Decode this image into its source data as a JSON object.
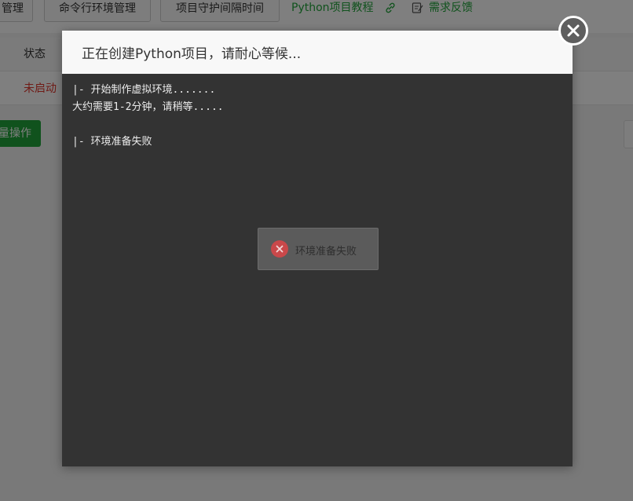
{
  "toolbar": {
    "buttons": [
      "管理",
      "命令行环境管理",
      "项目守护间隔时间"
    ],
    "tutorial_link": "Python项目教程",
    "feedback_link": "需求反馈"
  },
  "table": {
    "header_status": "状态",
    "row_status": "未启动"
  },
  "batch_button": "量操作",
  "modal": {
    "title": "正在创建Python项目，请耐心等候...",
    "log_lines": [
      "|- 开始制作虚拟环境.......",
      "大约需要1-2分钟，请稍等.....",
      "",
      "|- 环境准备失败"
    ]
  },
  "toast": {
    "message": "环境准备失败",
    "icon": "error-circle-icon"
  },
  "colors": {
    "accent_green": "#20a53a",
    "status_red": "#e0362c",
    "terminal_bg": "#333333",
    "error_red": "#d9534f"
  }
}
